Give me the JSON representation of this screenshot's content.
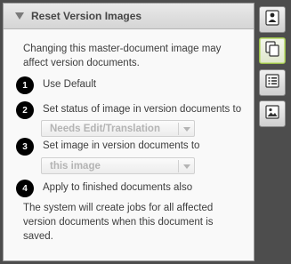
{
  "panel": {
    "title": "Reset Version Images",
    "intro": "Changing this master-document image may affect version documents.",
    "footer": "The system will create jobs for all affected version documents when this document is saved."
  },
  "steps": [
    {
      "number": "1",
      "label": "Use Default"
    },
    {
      "number": "2",
      "label": "Set status of image in version documents to"
    },
    {
      "number": "3",
      "label": "Set image in version documents to"
    },
    {
      "number": "4",
      "label": "Apply to finished documents also"
    }
  ],
  "selects": {
    "status": {
      "value": "Needs Edit/Translation"
    },
    "image": {
      "value": "this image"
    }
  },
  "sidebar": {
    "buttons": [
      {
        "name": "info",
        "icon": "person-info-icon",
        "active": false
      },
      {
        "name": "documents",
        "icon": "copy-documents-icon",
        "active": true
      },
      {
        "name": "list",
        "icon": "list-icon",
        "active": false
      },
      {
        "name": "image",
        "icon": "image-icon",
        "active": false
      }
    ]
  },
  "colors": {
    "accent_active": "#9bbf4a",
    "panel_bg": "#f9f9f9",
    "frame_bg": "#4d4d4d"
  }
}
